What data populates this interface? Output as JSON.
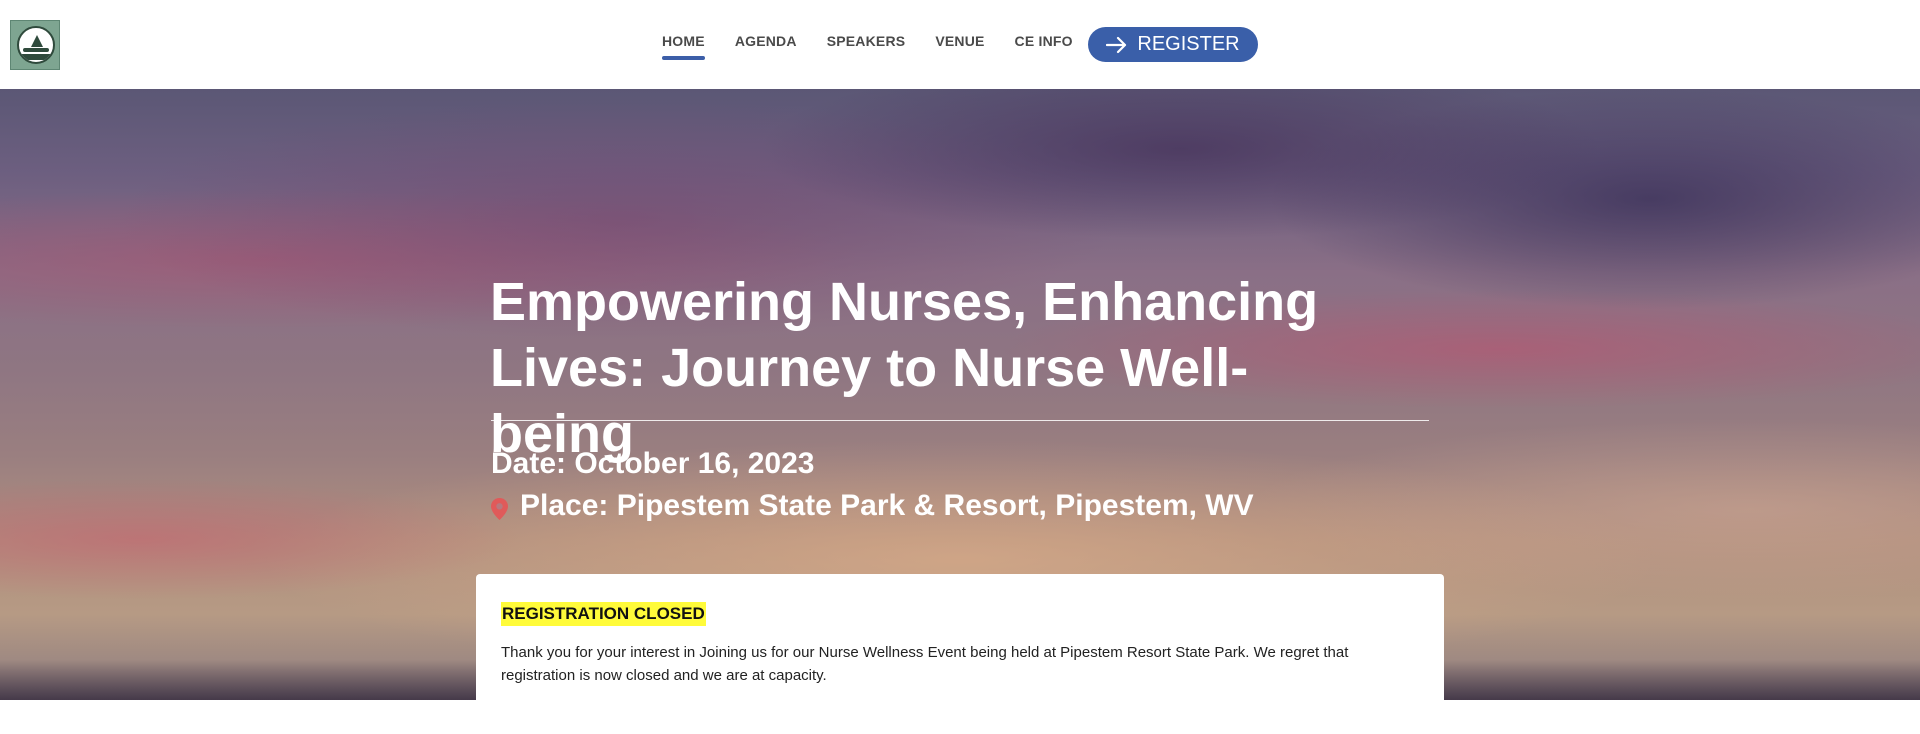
{
  "header": {
    "logo_alt": "HealthPath logo",
    "nav": [
      {
        "label": "HOME",
        "active": true
      },
      {
        "label": "AGENDA",
        "active": false
      },
      {
        "label": "SPEAKERS",
        "active": false
      },
      {
        "label": "VENUE",
        "active": false
      },
      {
        "label": "CE INFO",
        "active": false
      }
    ],
    "register_label": "REGISTER",
    "register_icon": "arrow-right-icon"
  },
  "hero": {
    "title": "Empowering Nurses, Enhancing Lives: Journey to Nurse Well-being",
    "date": "Date: October 16, 2023",
    "place": "Place: Pipestem State Park & Resort, Pipestem, WV",
    "place_icon": "map-pin-icon"
  },
  "notice": {
    "badge": "REGISTRATION CLOSED",
    "text": "Thank you for your interest in Joining us for our Nurse Wellness Event being held at Pipestem Resort State Park. We regret that registration is now closed and we are at capacity."
  },
  "colors": {
    "accent": "#3a5fa9",
    "highlight": "#fffb3a",
    "pin": "#e05a5a"
  }
}
